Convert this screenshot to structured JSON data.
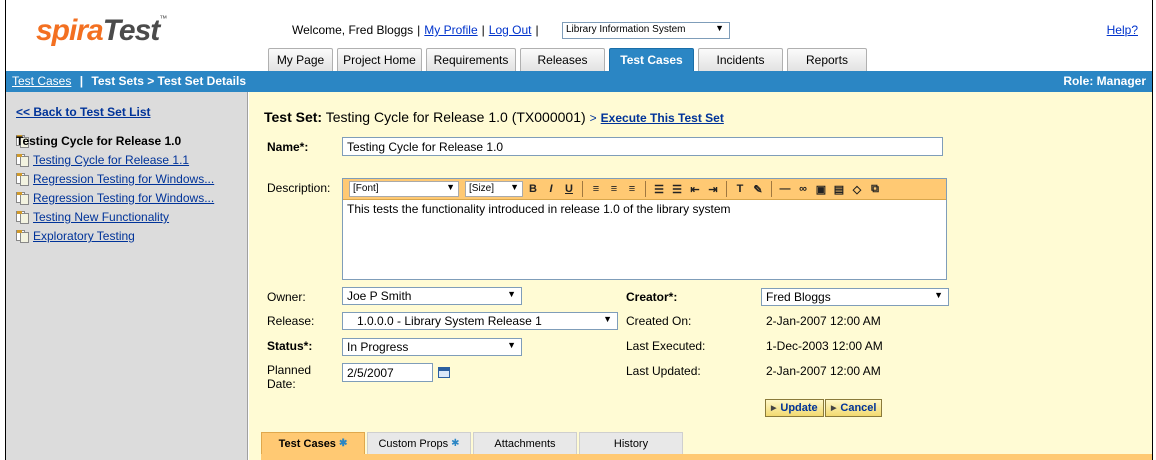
{
  "brand": {
    "part1": "spira",
    "part2": "Test",
    "tm": "™",
    "color": "#f37021"
  },
  "header": {
    "welcome": "Welcome, Fred Bloggs",
    "my_profile": "My Profile",
    "log_out": "Log Out",
    "project": "Library Information System",
    "help": "Help?"
  },
  "tabs": [
    {
      "label": "My Page"
    },
    {
      "label": "Project Home"
    },
    {
      "label": "Requirements"
    },
    {
      "label": "Releases"
    },
    {
      "label": "Test Cases",
      "active": true
    },
    {
      "label": "Incidents"
    },
    {
      "label": "Reports"
    }
  ],
  "breadcrumb": {
    "link": "Test Cases",
    "sep": "|",
    "current": "Test Sets > Test Set Details",
    "role": "Role: Manager"
  },
  "sidebar": {
    "back": "<< Back to Test Set List",
    "items": [
      {
        "label": "Testing Cycle for Release 1.0",
        "current": true
      },
      {
        "label": "Testing Cycle for Release 1.1"
      },
      {
        "label": "Regression Testing for Windows..."
      },
      {
        "label": "Regression Testing for Windows..."
      },
      {
        "label": "Testing New Functionality"
      },
      {
        "label": "Exploratory Testing"
      }
    ]
  },
  "main": {
    "title_prefix": "Test Set:",
    "title_text": "Testing Cycle for Release 1.0 (TX000001)",
    "title_arrow": ">",
    "execute_link": "Execute This Test Set",
    "name_label": "Name*:",
    "name_value": "Testing Cycle for Release 1.0",
    "description_label": "Description:",
    "font_select": "[Font]",
    "size_select": "[Size]",
    "description_value": "This tests the functionality introduced in release 1.0 of the library system",
    "owner_label": "Owner:",
    "owner_value": "Joe P Smith",
    "release_label": "Release:",
    "release_value": "1.0.0.0 - Library System Release 1",
    "status_label": "Status*:",
    "status_value": "In Progress",
    "planned_label_1": "Planned",
    "planned_label_2": "Date:",
    "planned_value": "2/5/2007",
    "creator_label": "Creator*:",
    "creator_value": "Fred Bloggs",
    "created_label": "Created On:",
    "created_value": "2-Jan-2007 12:00 AM",
    "executed_label": "Last Executed:",
    "executed_value": "1-Dec-2003 12:00 AM",
    "updated_label": "Last Updated:",
    "updated_value": "2-Jan-2007 12:00 AM",
    "update_button": "Update",
    "cancel_button": "Cancel"
  },
  "subtabs": [
    {
      "label": "Test Cases",
      "star": "✱",
      "active": true
    },
    {
      "label": "Custom Props",
      "star": "✱"
    },
    {
      "label": "Attachments"
    },
    {
      "label": "History"
    }
  ],
  "colors": {
    "accent": "#2b86c4",
    "panel": "#fffbd4",
    "toolbar": "#ffc973",
    "sidebar": "#dcdcdc"
  }
}
